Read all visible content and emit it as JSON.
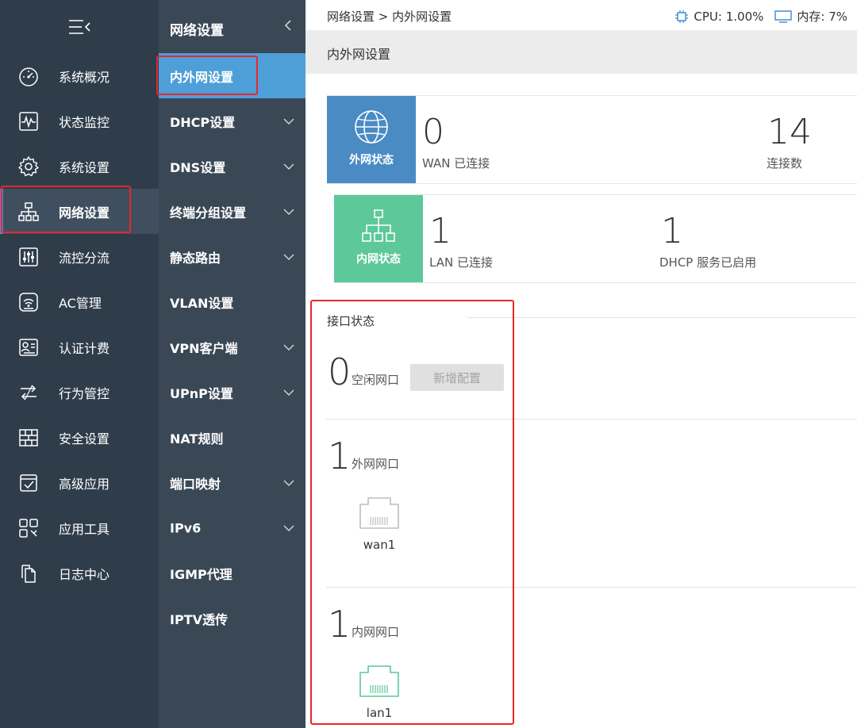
{
  "primary_nav": {
    "items": [
      {
        "label": "系统概况",
        "icon": "gauge-icon"
      },
      {
        "label": "状态监控",
        "icon": "pulse-monitor-icon"
      },
      {
        "label": "系统设置",
        "icon": "gear-icon"
      },
      {
        "label": "网络设置",
        "icon": "network-topology-icon",
        "active": true
      },
      {
        "label": "流控分流",
        "icon": "equalizer-icon"
      },
      {
        "label": "AC管理",
        "icon": "wifi-router-icon"
      },
      {
        "label": "认证计费",
        "icon": "id-card-icon"
      },
      {
        "label": "行为管控",
        "icon": "swap-arrows-icon"
      },
      {
        "label": "安全设置",
        "icon": "firewall-icon"
      },
      {
        "label": "高级应用",
        "icon": "checklist-icon"
      },
      {
        "label": "应用工具",
        "icon": "tools-grid-icon"
      },
      {
        "label": "日志中心",
        "icon": "documents-icon"
      }
    ]
  },
  "secondary_nav": {
    "title": "网络设置",
    "items": [
      {
        "label": "内外网设置",
        "active": true,
        "expandable": false
      },
      {
        "label": "DHCP设置",
        "expandable": true
      },
      {
        "label": "DNS设置",
        "expandable": true
      },
      {
        "label": "终端分组设置",
        "expandable": true
      },
      {
        "label": "静态路由",
        "expandable": true
      },
      {
        "label": "VLAN设置",
        "expandable": false
      },
      {
        "label": "VPN客户端",
        "expandable": true
      },
      {
        "label": "UPnP设置",
        "expandable": true
      },
      {
        "label": "NAT规则",
        "expandable": false
      },
      {
        "label": "端口映射",
        "expandable": true
      },
      {
        "label": "IPv6",
        "expandable": true
      },
      {
        "label": "IGMP代理",
        "expandable": false
      },
      {
        "label": "IPTV透传",
        "expandable": false
      }
    ]
  },
  "header": {
    "breadcrumb": "网络设置 > 内外网设置",
    "cpu": "CPU: 1.00%",
    "memory": "内存: 7%"
  },
  "page": {
    "title": "内外网设置"
  },
  "wan_card": {
    "badge": "外网状态",
    "connected_value": "0",
    "connected_label": "WAN 已连接",
    "connections_value": "14",
    "connections_label": "连接数"
  },
  "lan_card": {
    "badge": "内网状态",
    "connected_value": "1",
    "connected_label": "LAN 已连接",
    "dhcp_value": "1",
    "dhcp_label": "DHCP 服务已启用"
  },
  "interfaces": {
    "title": "接口状态",
    "idle": {
      "count": "0",
      "label": "空闲网口",
      "button": "新增配置"
    },
    "wan": {
      "count": "1",
      "label": "外网网口",
      "ports": [
        "wan1"
      ]
    },
    "lan": {
      "count": "1",
      "label": "内网网口",
      "ports": [
        "lan1"
      ]
    }
  },
  "colors": {
    "sidebar": "#2f3d4b",
    "subnav": "#3a4856",
    "active_subnav": "#4e9fd8",
    "wan_badge": "#4a8bc4",
    "lan_badge": "#5dc89a",
    "highlight": "#e8272a",
    "lan_port": "#5dc89a"
  }
}
